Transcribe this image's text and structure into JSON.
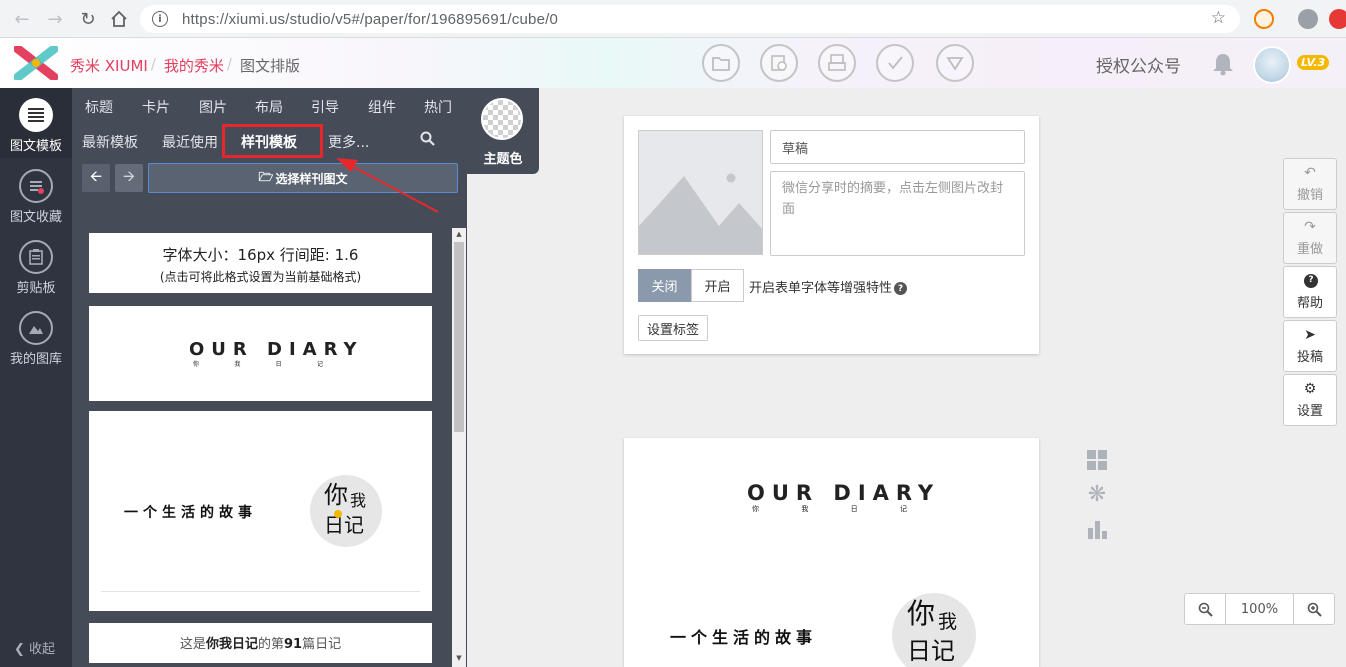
{
  "browser": {
    "url": "https://xiumi.us/studio/v5#/paper/for/196895691/cube/0"
  },
  "header": {
    "breadcrumbs": [
      "秀米 XIUMI",
      "我的秀米",
      "图文排版"
    ],
    "auth_link": "授权公众号",
    "level": "LV.3",
    "tools": [
      "folder-icon",
      "images-icon",
      "print-icon",
      "check-icon",
      "triangle-icon"
    ]
  },
  "rail": {
    "items": [
      {
        "label": "图文模板",
        "icon": "list-icon"
      },
      {
        "label": "图文收藏",
        "icon": "bookmark-icon"
      },
      {
        "label": "剪贴板",
        "icon": "clipboard-icon"
      },
      {
        "label": "我的图库",
        "icon": "gallery-icon"
      }
    ],
    "collapse": "收起"
  },
  "panel": {
    "tabs_top": [
      "标题",
      "卡片",
      "图片",
      "布局",
      "引导",
      "组件",
      "热门"
    ],
    "tabs_bottom": [
      "最新模板",
      "最近使用",
      "样刊模板",
      "更多..."
    ],
    "select_button": "选择样刊图文",
    "theme_label": "主题色"
  },
  "templates": {
    "font_card": {
      "line1": "字体大小：16px 行间距: 1.6",
      "line2": "(点击可将此格式设置为当前基础格式)"
    },
    "diary": {
      "title": "OUR DIARY",
      "sub": [
        "你",
        "我",
        "日",
        "记"
      ]
    },
    "story": {
      "text": "一个生活的故事",
      "stamp_top": "你",
      "stamp_right": "我",
      "stamp_bottom": "日记"
    },
    "footer_card": {
      "prefix": "这是",
      "bold1": "你我日记",
      "mid": "的第",
      "bold2": "91",
      "suffix": "篇日记"
    }
  },
  "editor": {
    "title_value": "草稿",
    "summary_placeholder": "微信分享时的摘要，点击左侧图片改封面",
    "toggle_off": "关闭",
    "toggle_on": "开启",
    "toggle_desc": "开启表单字体等增强特性",
    "tag_button": "设置标签"
  },
  "actions": [
    {
      "label": "撤销",
      "icon": "undo-icon",
      "glyph": "↶"
    },
    {
      "label": "重做",
      "icon": "redo-icon",
      "glyph": "↷"
    },
    {
      "label": "帮助",
      "icon": "help-icon",
      "glyph": "?"
    },
    {
      "label": "投稿",
      "icon": "send-icon",
      "glyph": "➤"
    },
    {
      "label": "设置",
      "icon": "gear-icon",
      "glyph": "⚙"
    }
  ],
  "zoom": {
    "value": "100%"
  },
  "colors": {
    "accent": "#e4405f",
    "highlight": "#e8272b",
    "panel": "#454c58",
    "rail": "#2f3440"
  }
}
